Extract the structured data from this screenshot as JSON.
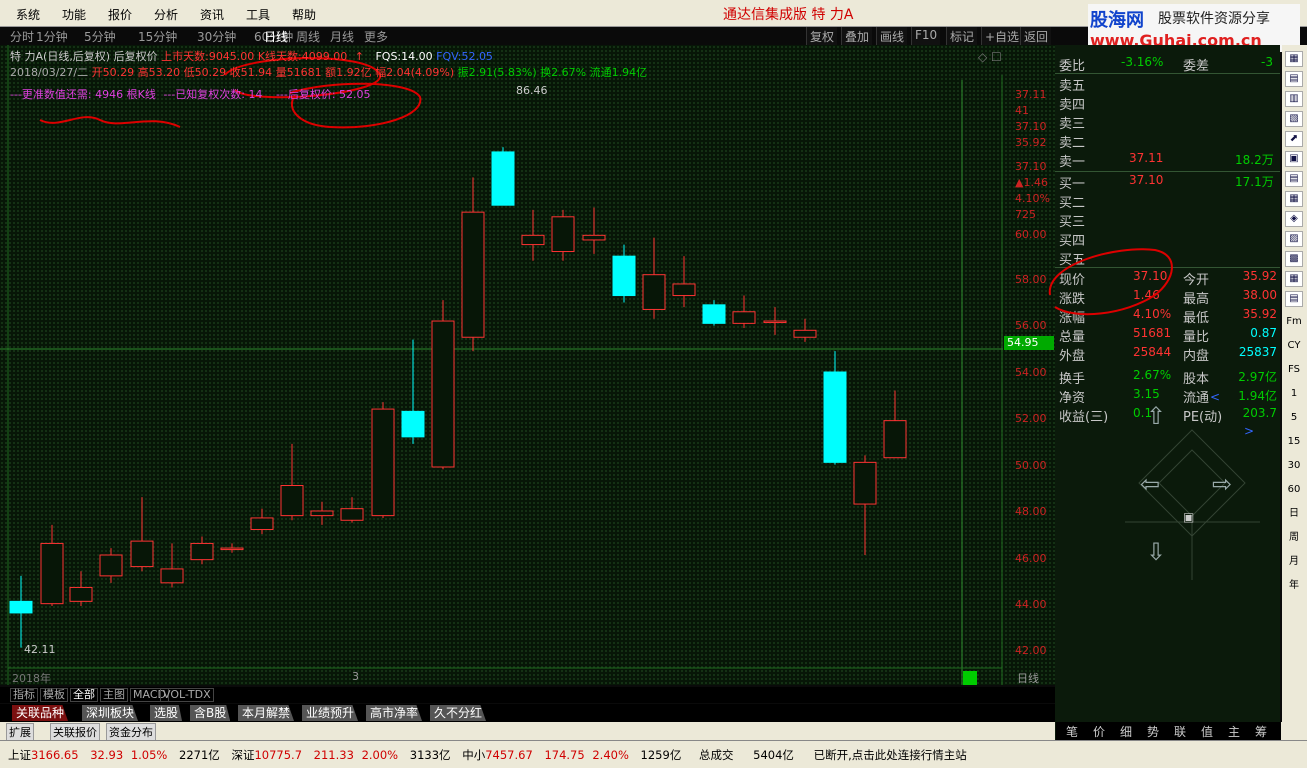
{
  "menu": [
    "系统",
    "功能",
    "报价",
    "分析",
    "资讯",
    "工具",
    "帮助"
  ],
  "app_title": "通达信集成版  特 力A",
  "logo": {
    "name": "股海网",
    "slogan": "股票软件资源分享",
    "url": "www.Guhai.com.cn"
  },
  "period_tabs": [
    "分时",
    "1分钟",
    "5分钟",
    "15分钟",
    "30分钟",
    "60分钟",
    "日线",
    "周线",
    "月线",
    "更多"
  ],
  "active_period": "日线",
  "toolbar_buttons": [
    "复权",
    "叠加",
    "画线",
    "F10",
    "标记",
    "+自选",
    "返回"
  ],
  "info": {
    "line1_name": "特 力A(日线,后复权)",
    "line1_prefix": "后复权价",
    "line1_listed": "上市天数:9045.00",
    "line1_kdays": "K线天数:4099.00",
    "line1_fqs": "FQS:14.00",
    "line1_fqsv": "FQV:52.05",
    "line2_date": "2018/03/27/二",
    "line2_open": "开50.29",
    "line2_high": "高53.20",
    "line2_low": "低50.29",
    "line2_close": "收51.94",
    "line2_vol": "量51681",
    "line2_amt": "额1.92亿",
    "line2_pct": "幅2.04(4.09%)",
    "line2_amp": "振2.91(5.83%)",
    "line2_turn": "换2.67%",
    "line2_float": "流通1.94亿",
    "line3_need": "---更准数值还需: 4946 根K线",
    "line3_times": "---已知复权次数: 14",
    "line3_price": "---后复权价: 52.05"
  },
  "price_axis": [
    "37.11",
    "41",
    "37.10",
    "35.92",
    "37.10",
    "▲1.46",
    "4.10%",
    "725",
    "60.00",
    "58.00",
    "56.00",
    "54.00",
    "52.00",
    "50.00",
    "48.00",
    "46.00",
    "44.00",
    "42.00"
  ],
  "price_marker": "54.95",
  "high_label": "86.46",
  "low_label": "42.11",
  "x_axis": {
    "year": "2018年",
    "mark": "3",
    "period_label": "日线"
  },
  "indicator_tabs": [
    "指标",
    "模板",
    "全部",
    "主图",
    "MACD",
    "VOL-TDX"
  ],
  "category_tabs": [
    "关联品种",
    "深圳板块",
    "选股",
    "含B股",
    "本月解禁",
    "业绩预升",
    "高市净率",
    "久不分红"
  ],
  "bottom_tabs": [
    "扩展",
    "关联报价",
    "资金分布"
  ],
  "right_panel": {
    "weibi_label": "委比",
    "weibi_val": "-3.16%",
    "weicha_label": "委差",
    "weicha_val": "-3",
    "sell": [
      {
        "label": "卖五",
        "price": "",
        "vol": ""
      },
      {
        "label": "卖四",
        "price": "",
        "vol": ""
      },
      {
        "label": "卖三",
        "price": "",
        "vol": ""
      },
      {
        "label": "卖二",
        "price": "",
        "vol": ""
      },
      {
        "label": "卖一",
        "price": "37.11",
        "vol": "18.2万"
      }
    ],
    "buy": [
      {
        "label": "买一",
        "price": "37.10",
        "vol": "17.1万"
      },
      {
        "label": "买二",
        "price": "",
        "vol": ""
      },
      {
        "label": "买三",
        "price": "",
        "vol": ""
      },
      {
        "label": "买四",
        "price": "",
        "vol": ""
      },
      {
        "label": "买五",
        "price": "",
        "vol": ""
      }
    ],
    "quote": [
      {
        "l1": "现价",
        "v1": "37.10",
        "l2": "今开",
        "v2": "35.92"
      },
      {
        "l1": "涨跌",
        "v1": "1.46",
        "l2": "最高",
        "v2": "38.00"
      },
      {
        "l1": "涨幅",
        "v1": "4.10%",
        "l2": "最低",
        "v2": "35.92"
      },
      {
        "l1": "总量",
        "v1": "51681",
        "l2": "量比",
        "v2": "0.87"
      },
      {
        "l1": "外盘",
        "v1": "25844",
        "l2": "内盘",
        "v2": "25837"
      },
      {
        "l1": "换手",
        "v1": "2.67%",
        "l2": "股本",
        "v2": "2.97亿"
      },
      {
        "l1": "净资",
        "v1": "3.15",
        "l2": "流通",
        "v2": "1.94亿"
      },
      {
        "l1": "收益(三)",
        "v1": "0.1",
        "l2": "PE(动)",
        "v2": "203.7"
      }
    ],
    "bottom_tabs": [
      "笔",
      "价",
      "细",
      "势",
      "联",
      "值",
      "主",
      "筹"
    ]
  },
  "status": {
    "sh_label": "上证",
    "sh_val": "3166.65",
    "sh_chg": "32.93",
    "sh_pct": "1.05%",
    "sh_amt": "2271亿",
    "sz_label": "深证",
    "sz_val": "10775.7",
    "sz_chg": "211.33",
    "sz_pct": "2.00%",
    "sz_amt": "3133亿",
    "zx_label": "中小",
    "zx_val": "7457.67",
    "zx_chg": "174.75",
    "zx_pct": "2.40%",
    "zx_amt": "1259亿",
    "total_label": "总成交",
    "total_val": "5404亿",
    "conn": "已断开,点击此处连接行情主站"
  },
  "side_icons": [
    "Fm",
    "CY",
    "FS",
    "1",
    "5",
    "15",
    "30",
    "60",
    "日",
    "周",
    "月",
    "年"
  ],
  "chart_data": {
    "type": "candlestick",
    "period": "日线",
    "candles": [
      {
        "o": 44.1,
        "c": 43.6,
        "h": 45.2,
        "l": 42.1
      },
      {
        "o": 44.0,
        "c": 46.6,
        "h": 47.4,
        "l": 43.9
      },
      {
        "o": 44.1,
        "c": 44.7,
        "h": 45.4,
        "l": 43.9
      },
      {
        "o": 45.2,
        "c": 46.1,
        "h": 46.4,
        "l": 44.9
      },
      {
        "o": 45.6,
        "c": 46.7,
        "h": 48.6,
        "l": 45.4
      },
      {
        "o": 44.9,
        "c": 45.5,
        "h": 46.6,
        "l": 44.7
      },
      {
        "o": 45.9,
        "c": 46.6,
        "h": 46.9,
        "l": 45.7
      },
      {
        "o": 46.4,
        "c": 46.4,
        "h": 46.6,
        "l": 46.2
      },
      {
        "o": 47.2,
        "c": 47.7,
        "h": 48.1,
        "l": 47.0
      },
      {
        "o": 47.8,
        "c": 49.1,
        "h": 50.9,
        "l": 47.6
      },
      {
        "o": 47.8,
        "c": 48.0,
        "h": 48.4,
        "l": 47.4
      },
      {
        "o": 47.6,
        "c": 48.1,
        "h": 48.6,
        "l": 47.5
      },
      {
        "o": 47.8,
        "c": 52.4,
        "h": 52.7,
        "l": 47.7
      },
      {
        "o": 52.3,
        "c": 51.2,
        "h": 55.4,
        "l": 50.9
      },
      {
        "o": 49.9,
        "c": 56.2,
        "h": 57.1,
        "l": 49.8
      },
      {
        "o": 55.5,
        "c": 60.9,
        "h": 62.4,
        "l": 54.9
      },
      {
        "o": 63.5,
        "c": 61.2,
        "h": 63.7,
        "l": 61.2
      },
      {
        "o": 59.5,
        "c": 59.9,
        "h": 61.0,
        "l": 58.8
      },
      {
        "o": 59.2,
        "c": 60.7,
        "h": 61.0,
        "l": 58.8
      },
      {
        "o": 59.7,
        "c": 59.9,
        "h": 61.1,
        "l": 59.1
      },
      {
        "o": 59.0,
        "c": 57.3,
        "h": 59.5,
        "l": 57.0
      },
      {
        "o": 56.7,
        "c": 58.2,
        "h": 59.8,
        "l": 56.3
      },
      {
        "o": 57.3,
        "c": 57.8,
        "h": 59.0,
        "l": 56.8
      },
      {
        "o": 56.9,
        "c": 56.1,
        "h": 57.1,
        "l": 56.0
      },
      {
        "o": 56.1,
        "c": 56.6,
        "h": 57.3,
        "l": 55.9
      },
      {
        "o": 56.2,
        "c": 56.2,
        "h": 56.8,
        "l": 55.6
      },
      {
        "o": 55.5,
        "c": 55.8,
        "h": 56.3,
        "l": 55.3
      },
      {
        "o": 54.0,
        "c": 50.1,
        "h": 54.9,
        "l": 50.0
      },
      {
        "o": 48.3,
        "c": 50.1,
        "h": 50.4,
        "l": 46.1
      },
      {
        "o": 50.3,
        "c": 51.9,
        "h": 53.2,
        "l": 50.3
      }
    ]
  }
}
